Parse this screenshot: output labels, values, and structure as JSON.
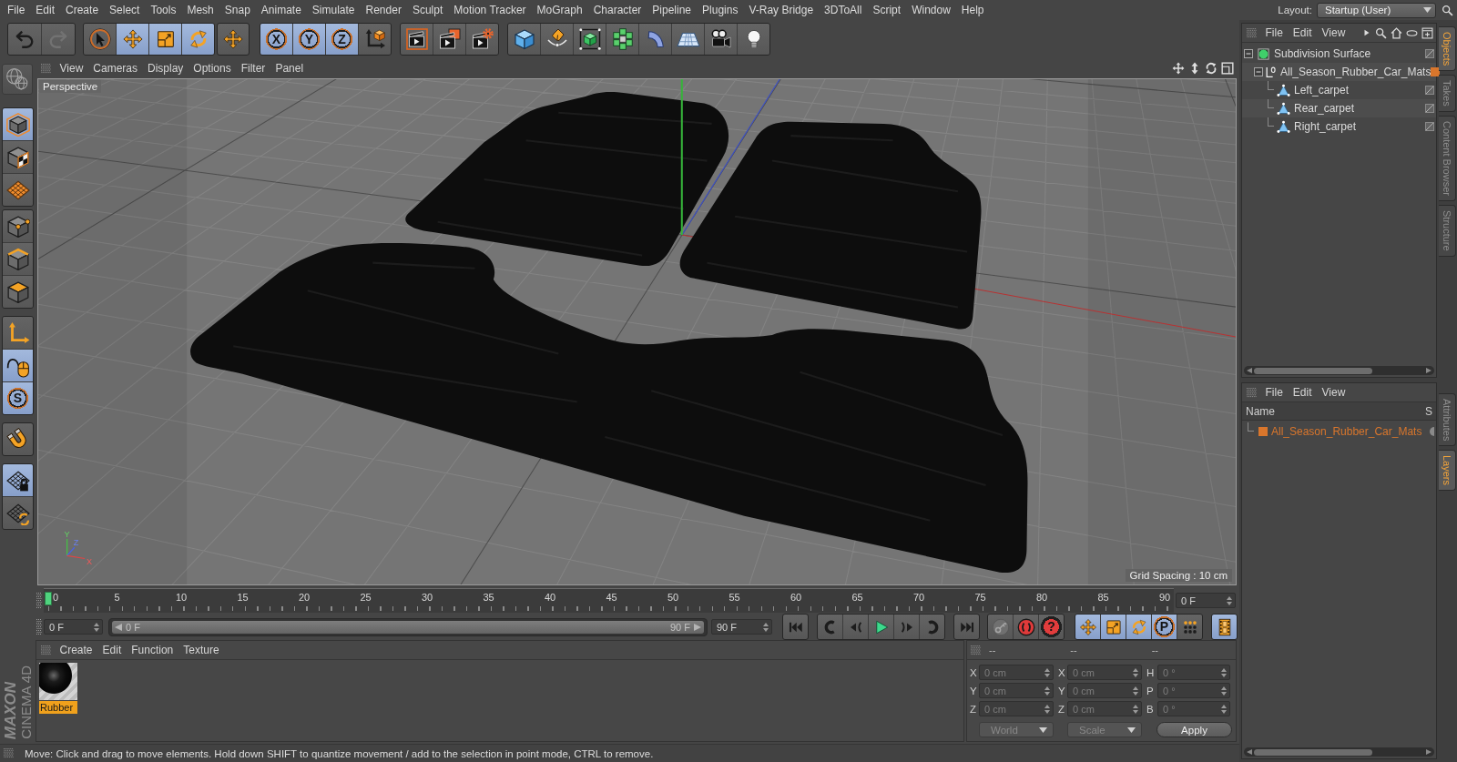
{
  "menu_bar": {
    "items": [
      "File",
      "Edit",
      "Create",
      "Select",
      "Tools",
      "Mesh",
      "Snap",
      "Animate",
      "Simulate",
      "Render",
      "Sculpt",
      "Motion Tracker",
      "MoGraph",
      "Character",
      "Pipeline",
      "Plugins",
      "V-Ray Bridge",
      "3DToAll",
      "Script",
      "Window",
      "Help"
    ],
    "layout_label": "Layout:",
    "layout_value": "Startup (User)"
  },
  "toolbar": {
    "history": [
      {
        "disabled": false
      },
      {
        "disabled": true
      }
    ],
    "tools": [
      {
        "selected": false
      },
      {
        "selected": true
      },
      {
        "selected": true
      },
      {
        "selected": true
      }
    ],
    "axis_locks": [
      {
        "label": "X",
        "selected": true
      },
      {
        "label": "Y",
        "selected": true
      },
      {
        "label": "Z",
        "selected": true
      }
    ]
  },
  "mode_palette": {
    "groups": [
      [
        {
          "selected": true
        },
        {
          "selected": false
        },
        {
          "selected": false
        }
      ],
      [
        {
          "selected": false
        },
        {
          "selected": false
        },
        {
          "selected": false
        }
      ],
      [
        {
          "selected": false
        },
        {
          "selected": true
        },
        {
          "label": "S",
          "selected": true
        }
      ],
      [
        {
          "selected": false
        }
      ],
      [
        {
          "selected": true
        },
        {
          "selected": false
        }
      ]
    ]
  },
  "viewport": {
    "menu": [
      "View",
      "Cameras",
      "Display",
      "Options",
      "Filter",
      "Panel"
    ],
    "camera": "Perspective",
    "gizmo": {
      "y": "Y",
      "z": "Z",
      "x": "X"
    },
    "grid_spacing": "Grid Spacing : 10 cm"
  },
  "timeline": {
    "ticks": [
      "0",
      "5",
      "10",
      "15",
      "20",
      "25",
      "30",
      "35",
      "40",
      "45",
      "50",
      "55",
      "60",
      "65",
      "70",
      "75",
      "80",
      "85",
      "90"
    ],
    "playhead": {
      "level": 0
    },
    "current_frame": "0 F"
  },
  "range": {
    "start": "0 F",
    "level": 1,
    "slider_start": "0 F",
    "slider_end": "90 F",
    "end": "90 F"
  },
  "animation_keys": {
    "help_label": "?",
    "keys": [
      {
        "selected": true
      },
      {
        "selected": true
      },
      {
        "selected": true
      },
      {
        "label": "P",
        "selected": true
      },
      {
        "selected": false
      }
    ],
    "timeline_toggle": {
      "selected": true
    }
  },
  "materials": {
    "menu": [
      "Create",
      "Edit",
      "Function",
      "Texture"
    ],
    "items": [
      {
        "name": "Rubber",
        "selected": true
      }
    ]
  },
  "coordinates": {
    "disabled": true,
    "columns": [
      "--",
      "--",
      "--"
    ],
    "rows": [
      {
        "position_axis": "X",
        "position": "0 cm",
        "size_axis": "X",
        "size": "0 cm",
        "rotation_axis": "H",
        "rotation": "0 °"
      },
      {
        "position_axis": "Y",
        "position": "0 cm",
        "size_axis": "Y",
        "size": "0 cm",
        "rotation_axis": "P",
        "rotation": "0 °"
      },
      {
        "position_axis": "Z",
        "position": "0 cm",
        "size_axis": "Z",
        "size": "0 cm",
        "rotation_axis": "B",
        "rotation": "0 °"
      }
    ],
    "space": "World",
    "mode": "Scale",
    "apply": "Apply"
  },
  "logo": {
    "brand": "MAXON",
    "product": "CINEMA 4D"
  },
  "status_bar": "Move: Click and drag to move elements. Hold down SHIFT to quantize movement / add to the selection in point mode, CTRL to remove.",
  "objects": {
    "menu": [
      "File",
      "Edit",
      "View"
    ],
    "tree": [
      {
        "name": "Subdivision Surface",
        "kind": "generator",
        "expanded": true,
        "children": [
          {
            "name": "All_Season_Rubber_Car_Mats",
            "kind": "null",
            "expanded": true,
            "color": "#d9762c",
            "children": [
              {
                "name": "Left_carpet",
                "kind": "polygon"
              },
              {
                "name": "Rear_carpet",
                "kind": "polygon"
              },
              {
                "name": "Right_carpet",
                "kind": "polygon"
              }
            ]
          }
        ]
      }
    ]
  },
  "layers": {
    "menu": [
      "File",
      "Edit",
      "View"
    ],
    "columns": [
      "Name",
      "S"
    ],
    "rows": [
      {
        "name": "All_Season_Rubber_Car_Mats",
        "color": "#d9762c"
      }
    ]
  },
  "side_tabs": {
    "top": [
      {
        "label": "Objects",
        "selected": true
      },
      {
        "label": "Takes",
        "selected": false
      },
      {
        "label": "Content Browser",
        "selected": false
      },
      {
        "label": "Structure",
        "selected": false
      }
    ],
    "bottom": [
      {
        "label": "Attributes",
        "selected": false
      },
      {
        "label": "Layers",
        "selected": true
      }
    ]
  }
}
